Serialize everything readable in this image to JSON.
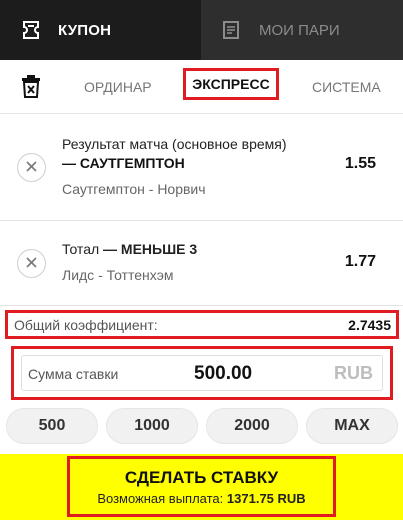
{
  "tabs": {
    "coupon": "КУПОН",
    "my_bets": "МОИ ПАРИ"
  },
  "modes": {
    "single": "ОРДИНАР",
    "express": "ЭКСПРЕСС",
    "system": "СИСТЕМА",
    "active": "express"
  },
  "bets": [
    {
      "market": "Результат матча (основное время)",
      "selection": "— САУТГЕМПТОН",
      "event": "Саутгемптон - Норвич",
      "odds": "1.55"
    },
    {
      "market": "Тотал",
      "selection": "— МЕНЬШЕ 3",
      "event": "Лидс - Тоттенхэм",
      "odds": "1.77"
    }
  ],
  "total": {
    "label": "Общий коэффициент:",
    "value": "2.7435"
  },
  "stake": {
    "label": "Сумма ставки",
    "value": "500.00",
    "currency": "RUB"
  },
  "quick_amounts": [
    "500",
    "1000",
    "2000",
    "MAX"
  ],
  "place_bet": {
    "label": "СДЕЛАТЬ СТАВКУ",
    "payout_label": "Возможная выплата:",
    "payout_value": "1371.75 RUB"
  },
  "icons": {
    "coupon": "ticket-icon",
    "my_bets": "document-icon",
    "clear": "trash-icon",
    "remove": "close-icon"
  },
  "colors": {
    "highlight": "#e01b22",
    "action": "#ffff00",
    "header_active": "#1c1c1c",
    "header_inactive": "#2e2e2e"
  }
}
